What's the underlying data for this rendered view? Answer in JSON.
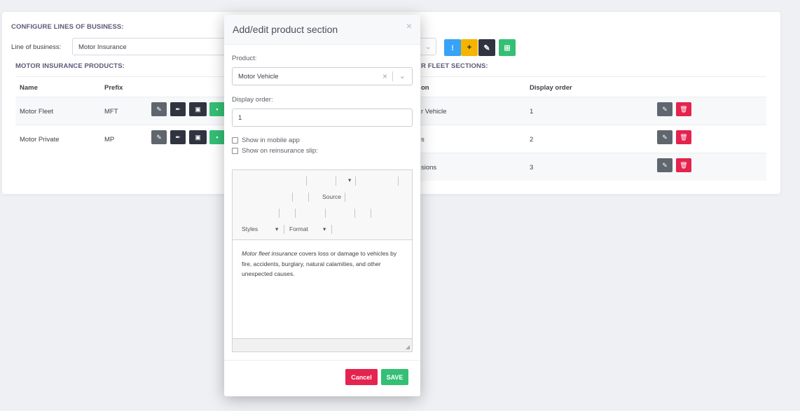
{
  "page": {
    "configure_title": "CONFIGURE LINES OF BUSINESS:",
    "line_of_business_label": "Line of business:",
    "line_of_business_value": "Motor Insurance",
    "products_title": "MOTOR INSURANCE PRODUCTS:",
    "sections_title": "R FLEET SECTIONS:"
  },
  "top_buttons": [
    {
      "name": "info",
      "icon": "info-icon",
      "glyph": "⁝",
      "color": "#36a3f7"
    },
    {
      "name": "add",
      "icon": "plus-icon",
      "glyph": "+",
      "color": "#f4b400"
    },
    {
      "name": "edit",
      "icon": "edit-icon",
      "glyph": "✎",
      "color": "#2f3440"
    },
    {
      "name": "add-box",
      "icon": "plus-square-icon",
      "glyph": "⊞",
      "color": "#34bf75"
    }
  ],
  "products_table": {
    "headers": [
      "Name",
      "Prefix"
    ],
    "rows": [
      {
        "name": "Motor Fleet",
        "prefix": "MFT"
      },
      {
        "name": "Motor Private",
        "prefix": "MP"
      }
    ]
  },
  "sections_table": {
    "headers": [
      "on",
      "Display order"
    ],
    "rows": [
      {
        "section": "r Vehicle",
        "order": "1"
      },
      {
        "section": "s",
        "order": "2"
      },
      {
        "section": "sions",
        "order": "3"
      }
    ]
  },
  "modal": {
    "title": "Add/edit product section",
    "close": "×",
    "product_label": "Product:",
    "product_value": "Motor Vehicle",
    "display_order_label": "Display order:",
    "display_order_value": "1",
    "show_mobile_label": "Show in mobile app",
    "show_reinsurance_label": "Show on reinsurance slip:",
    "toolbar": {
      "source_label": "Source",
      "styles_label": "Styles",
      "format_label": "Format"
    },
    "editor_italic": "Motor fleet insurance",
    "editor_text": " covers loss or damage to vehicles by fire, accidents, burglary, natural calamities, and other unexpected causes.",
    "cancel_label": "Cancel",
    "save_label": "SAVE"
  },
  "colors": {
    "accent_blue": "#36a3f7",
    "warning": "#f4b400",
    "success": "#34bf75",
    "danger": "#e4234e",
    "dark": "#2f3440",
    "gray": "#5f666e"
  }
}
